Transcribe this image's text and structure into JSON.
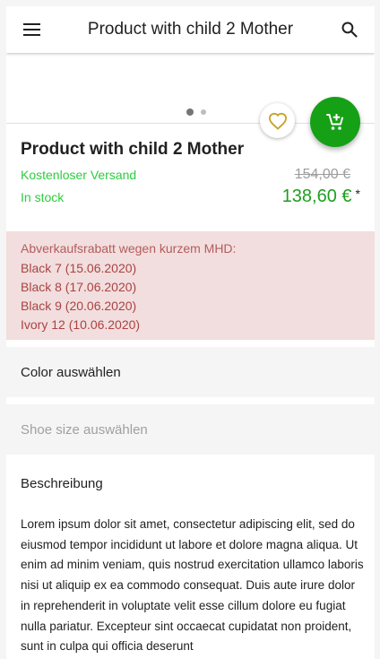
{
  "header": {
    "title": "Product with child 2 Mother",
    "menu_icon": "menu-icon",
    "search_icon": "search-icon"
  },
  "carousel": {
    "slide_count": 2,
    "active_index": 0
  },
  "actions": {
    "favorite_icon": "heart-outline-icon",
    "cart_icon": "add-shopping-cart-icon"
  },
  "product": {
    "title": "Product with child 2 Mother",
    "shipping": "Kostenloser Versand",
    "stock": "In stock",
    "old_price": "154,00 €",
    "price": "138,60 €",
    "price_note": "*"
  },
  "discount": {
    "heading": "Abverkaufsrabatt wegen kurzem MHD:",
    "items": [
      "Black 7 (15.06.2020)",
      "Black 8 (17.06.2020)",
      "Black 9 (20.06.2020)",
      "Ivory 12 (10.06.2020)"
    ]
  },
  "options": {
    "color_label": "Color auswählen",
    "shoe_label": "Shoe size auswählen"
  },
  "description": {
    "title": "Beschreibung",
    "text": "Lorem ipsum dolor sit amet, consectetur adipiscing elit, sed do eiusmod tempor incididunt ut labore et dolore magna aliqua. Ut enim ad minim veniam, quis nostrud exercitation ullamco laboris nisi ut aliquip ex ea commodo consequat. Duis aute irure dolor in reprehenderit in voluptate velit esse cillum dolore eu fugiat nulla pariatur. Excepteur sint occaecat cupidatat non proident, sunt in culpa qui officia deserunt"
  },
  "colors": {
    "green": "#16a016",
    "price_green": "#1e9e1e",
    "text_green": "#2ecc40",
    "heart_gold": "#c9a227",
    "discount_bg": "#f2dede",
    "discount_text": "#a94442",
    "discount_heading": "#b35c5c",
    "dot_active": "#757575",
    "dot_inactive": "#bdbdbd"
  }
}
